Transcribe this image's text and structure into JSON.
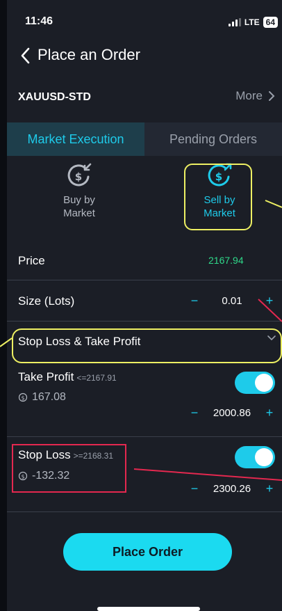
{
  "status_bar": {
    "time": "11:46",
    "network": "LTE",
    "battery": "64"
  },
  "nav": {
    "title": "Place an Order"
  },
  "symbol": {
    "name": "XAUUSD-STD",
    "more_label": "More"
  },
  "tabs": [
    {
      "label": "Market Execution",
      "active": true
    },
    {
      "label": "Pending Orders",
      "active": false
    }
  ],
  "directions": {
    "buy": {
      "line1": "Buy by",
      "line2": "Market",
      "icon": "dollar-down-arrow-icon"
    },
    "sell": {
      "line1": "Sell by",
      "line2": "Market",
      "icon": "dollar-up-arrow-icon",
      "selected": true
    }
  },
  "price": {
    "label": "Price",
    "value": "2167.94"
  },
  "size": {
    "label": "Size (Lots)",
    "minus": "−",
    "value": "0.01",
    "plus": "+"
  },
  "sltp": {
    "label": "Stop Loss & Take Profit",
    "expanded": true
  },
  "take_profit": {
    "label": "Take Profit",
    "condition": "<=2167.91",
    "pnl": "167.08",
    "value": "2000.86",
    "minus": "−",
    "plus": "+",
    "enabled": true
  },
  "stop_loss": {
    "label": "Stop Loss",
    "condition": ">=2168.31",
    "pnl": "-132.32",
    "value": "2300.26",
    "minus": "−",
    "plus": "+",
    "enabled": true
  },
  "actions": {
    "place_order": "Place Order"
  },
  "colors": {
    "accent": "#1ecbea",
    "price_green": "#2fd98a",
    "highlight_yellow": "#eef063",
    "highlight_red": "#e4284f",
    "background": "#1b1e26"
  }
}
